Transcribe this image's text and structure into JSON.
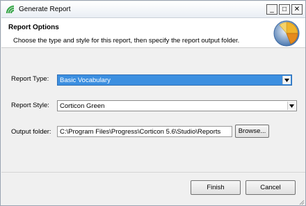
{
  "window": {
    "title": "Generate Report",
    "controls": {
      "minimize": "_",
      "maximize": "□",
      "close": "✕"
    },
    "icon": "corticon-app-icon"
  },
  "header": {
    "title": "Report Options",
    "description": "Choose the type and style for this report, then specify the report output folder.",
    "graphic": "pie-chart-icon"
  },
  "form": {
    "report_type": {
      "label": "Report Type:",
      "value": "Basic Vocabulary"
    },
    "report_style": {
      "label": "Report Style:",
      "value": "Corticon Green"
    },
    "output_folder": {
      "label": "Output folder:",
      "value": "C:\\Program Files\\Progress\\Corticon 5.6\\Studio\\Reports"
    },
    "browse_label": "Browse..."
  },
  "footer": {
    "finish_label": "Finish",
    "cancel_label": "Cancel"
  },
  "colors": {
    "selection": "#3c8fe0",
    "window_bg": "#f0f0f0"
  }
}
